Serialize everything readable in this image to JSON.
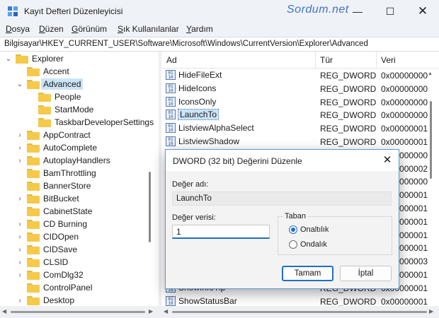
{
  "window": {
    "title": "Kayıt Defteri Düzenleyicisi",
    "watermark": "Sordum.net",
    "controls": {
      "minimize": "—",
      "maximize": "☐",
      "close": "✕"
    }
  },
  "menu": [
    "Dosya",
    "Düzen",
    "Görünüm",
    "Sık Kullanılanlar",
    "Yardım"
  ],
  "address": "Bilgisayar\\HKEY_CURRENT_USER\\Software\\Microsoft\\Windows\\CurrentVersion\\Explorer\\Advanced",
  "tree": [
    {
      "label": "Explorer",
      "level": 0,
      "chevron": "⌄"
    },
    {
      "label": "Accent",
      "level": 1,
      "chevron": ""
    },
    {
      "label": "Advanced",
      "level": 1,
      "chevron": "⌄",
      "selected": true
    },
    {
      "label": "People",
      "level": 2,
      "chevron": ""
    },
    {
      "label": "StartMode",
      "level": 2,
      "chevron": ""
    },
    {
      "label": "TaskbarDeveloperSettings",
      "level": 2,
      "chevron": ""
    },
    {
      "label": "AppContract",
      "level": 1,
      "chevron": "›"
    },
    {
      "label": "AutoComplete",
      "level": 1,
      "chevron": "›"
    },
    {
      "label": "AutoplayHandlers",
      "level": 1,
      "chevron": "›"
    },
    {
      "label": "BamThrottling",
      "level": 1,
      "chevron": ""
    },
    {
      "label": "BannerStore",
      "level": 1,
      "chevron": ""
    },
    {
      "label": "BitBucket",
      "level": 1,
      "chevron": "›"
    },
    {
      "label": "CabinetState",
      "level": 1,
      "chevron": ""
    },
    {
      "label": "CD Burning",
      "level": 1,
      "chevron": "›"
    },
    {
      "label": "CIDOpen",
      "level": 1,
      "chevron": "›"
    },
    {
      "label": "CIDSave",
      "level": 1,
      "chevron": "›"
    },
    {
      "label": "CLSID",
      "level": 1,
      "chevron": "›"
    },
    {
      "label": "ComDlg32",
      "level": 1,
      "chevron": "›"
    },
    {
      "label": "ControlPanel",
      "level": 1,
      "chevron": ""
    },
    {
      "label": "Desktop",
      "level": 1,
      "chevron": "›"
    }
  ],
  "list": {
    "headers": {
      "name": "Ad",
      "type": "Tür",
      "data": "Veri"
    },
    "rows": [
      {
        "name": "HideFileExt",
        "type": "REG_DWORD",
        "data": "0x00000000"
      },
      {
        "name": "HideIcons",
        "type": "REG_DWORD",
        "data": "0x00000000"
      },
      {
        "name": "IconsOnly",
        "type": "REG_DWORD",
        "data": "0x00000000"
      },
      {
        "name": "LaunchTo",
        "type": "REG_DWORD",
        "data": "0x00000000",
        "selected": true
      },
      {
        "name": "ListviewAlphaSelect",
        "type": "REG_DWORD",
        "data": "0x00000001"
      },
      {
        "name": "ListviewShadow",
        "type": "REG_DWORD",
        "data": "0x00000001"
      },
      {
        "name": "",
        "type": "",
        "data": "0x00000000"
      },
      {
        "name": "",
        "type": "",
        "data": "0x00000002"
      },
      {
        "name": "",
        "type": "",
        "data": "0x00000000"
      },
      {
        "name": "",
        "type": "",
        "data": "0x00000001"
      },
      {
        "name": "",
        "type": "",
        "data": "0x00000001"
      },
      {
        "name": "",
        "type": "",
        "data": "0x00000001"
      },
      {
        "name": "",
        "type": "",
        "data": "0x00000001"
      },
      {
        "name": "",
        "type": "",
        "data": "0x00000001"
      },
      {
        "name": "",
        "type": "",
        "data": "0x00000003"
      },
      {
        "name": "",
        "type": "",
        "data": "0x00000001"
      },
      {
        "name": "ShowInfoTip",
        "type": "REG_DWORD",
        "data": "0x00000001"
      },
      {
        "name": "ShowStatusBar",
        "type": "REG_DWORD",
        "data": "0x00000001"
      }
    ]
  },
  "dialog": {
    "title": "DWORD (32 bit) Değerini Düzenle",
    "close": "✕",
    "name_label": "Değer adı:",
    "name_value": "LaunchTo",
    "data_label": "Değer verisi:",
    "data_value": "1",
    "base_group": "Taban",
    "radio_hex": "Onaltılık",
    "radio_dec": "Ondalık",
    "base_selected": "Onaltılık",
    "ok": "Tamam",
    "cancel": "İptal"
  },
  "colors": {
    "accent": "#1f6fc5",
    "selection": "#cce4f7",
    "folder": "#f5c94a",
    "watermark": "#3f74c4"
  }
}
